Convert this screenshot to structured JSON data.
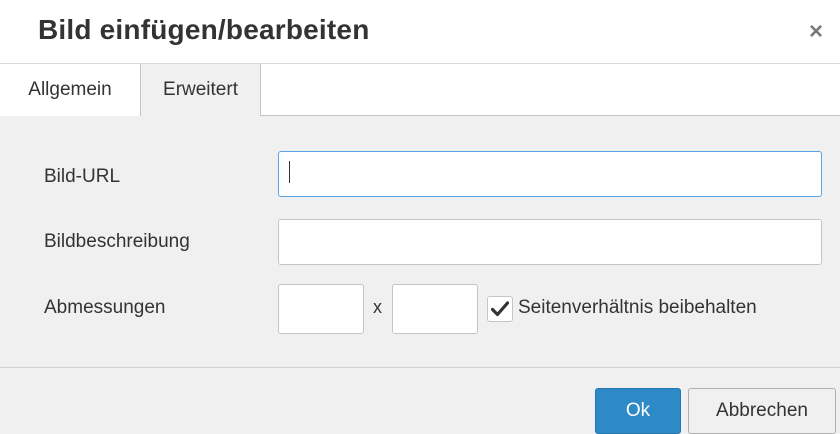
{
  "dialog": {
    "title": "Bild einfügen/bearbeiten",
    "close_label": "×"
  },
  "tabs": [
    {
      "label": "Allgemein",
      "active": true
    },
    {
      "label": "Erweitert",
      "active": false
    }
  ],
  "form": {
    "image_url_label": "Bild-URL",
    "image_url_value": "",
    "description_label": "Bildbeschreibung",
    "description_value": "",
    "dimensions_label": "Abmessungen",
    "width_value": "",
    "dimension_separator": "x",
    "height_value": "",
    "keep_ratio_label": "Seitenverhältnis beibehalten",
    "keep_ratio_checked": true
  },
  "buttons": {
    "ok_label": "Ok",
    "cancel_label": "Abbrechen"
  },
  "colors": {
    "primary_button": "#2d8ac7",
    "focus_border": "#59a5e5",
    "panel_background": "#f0f0f0"
  }
}
